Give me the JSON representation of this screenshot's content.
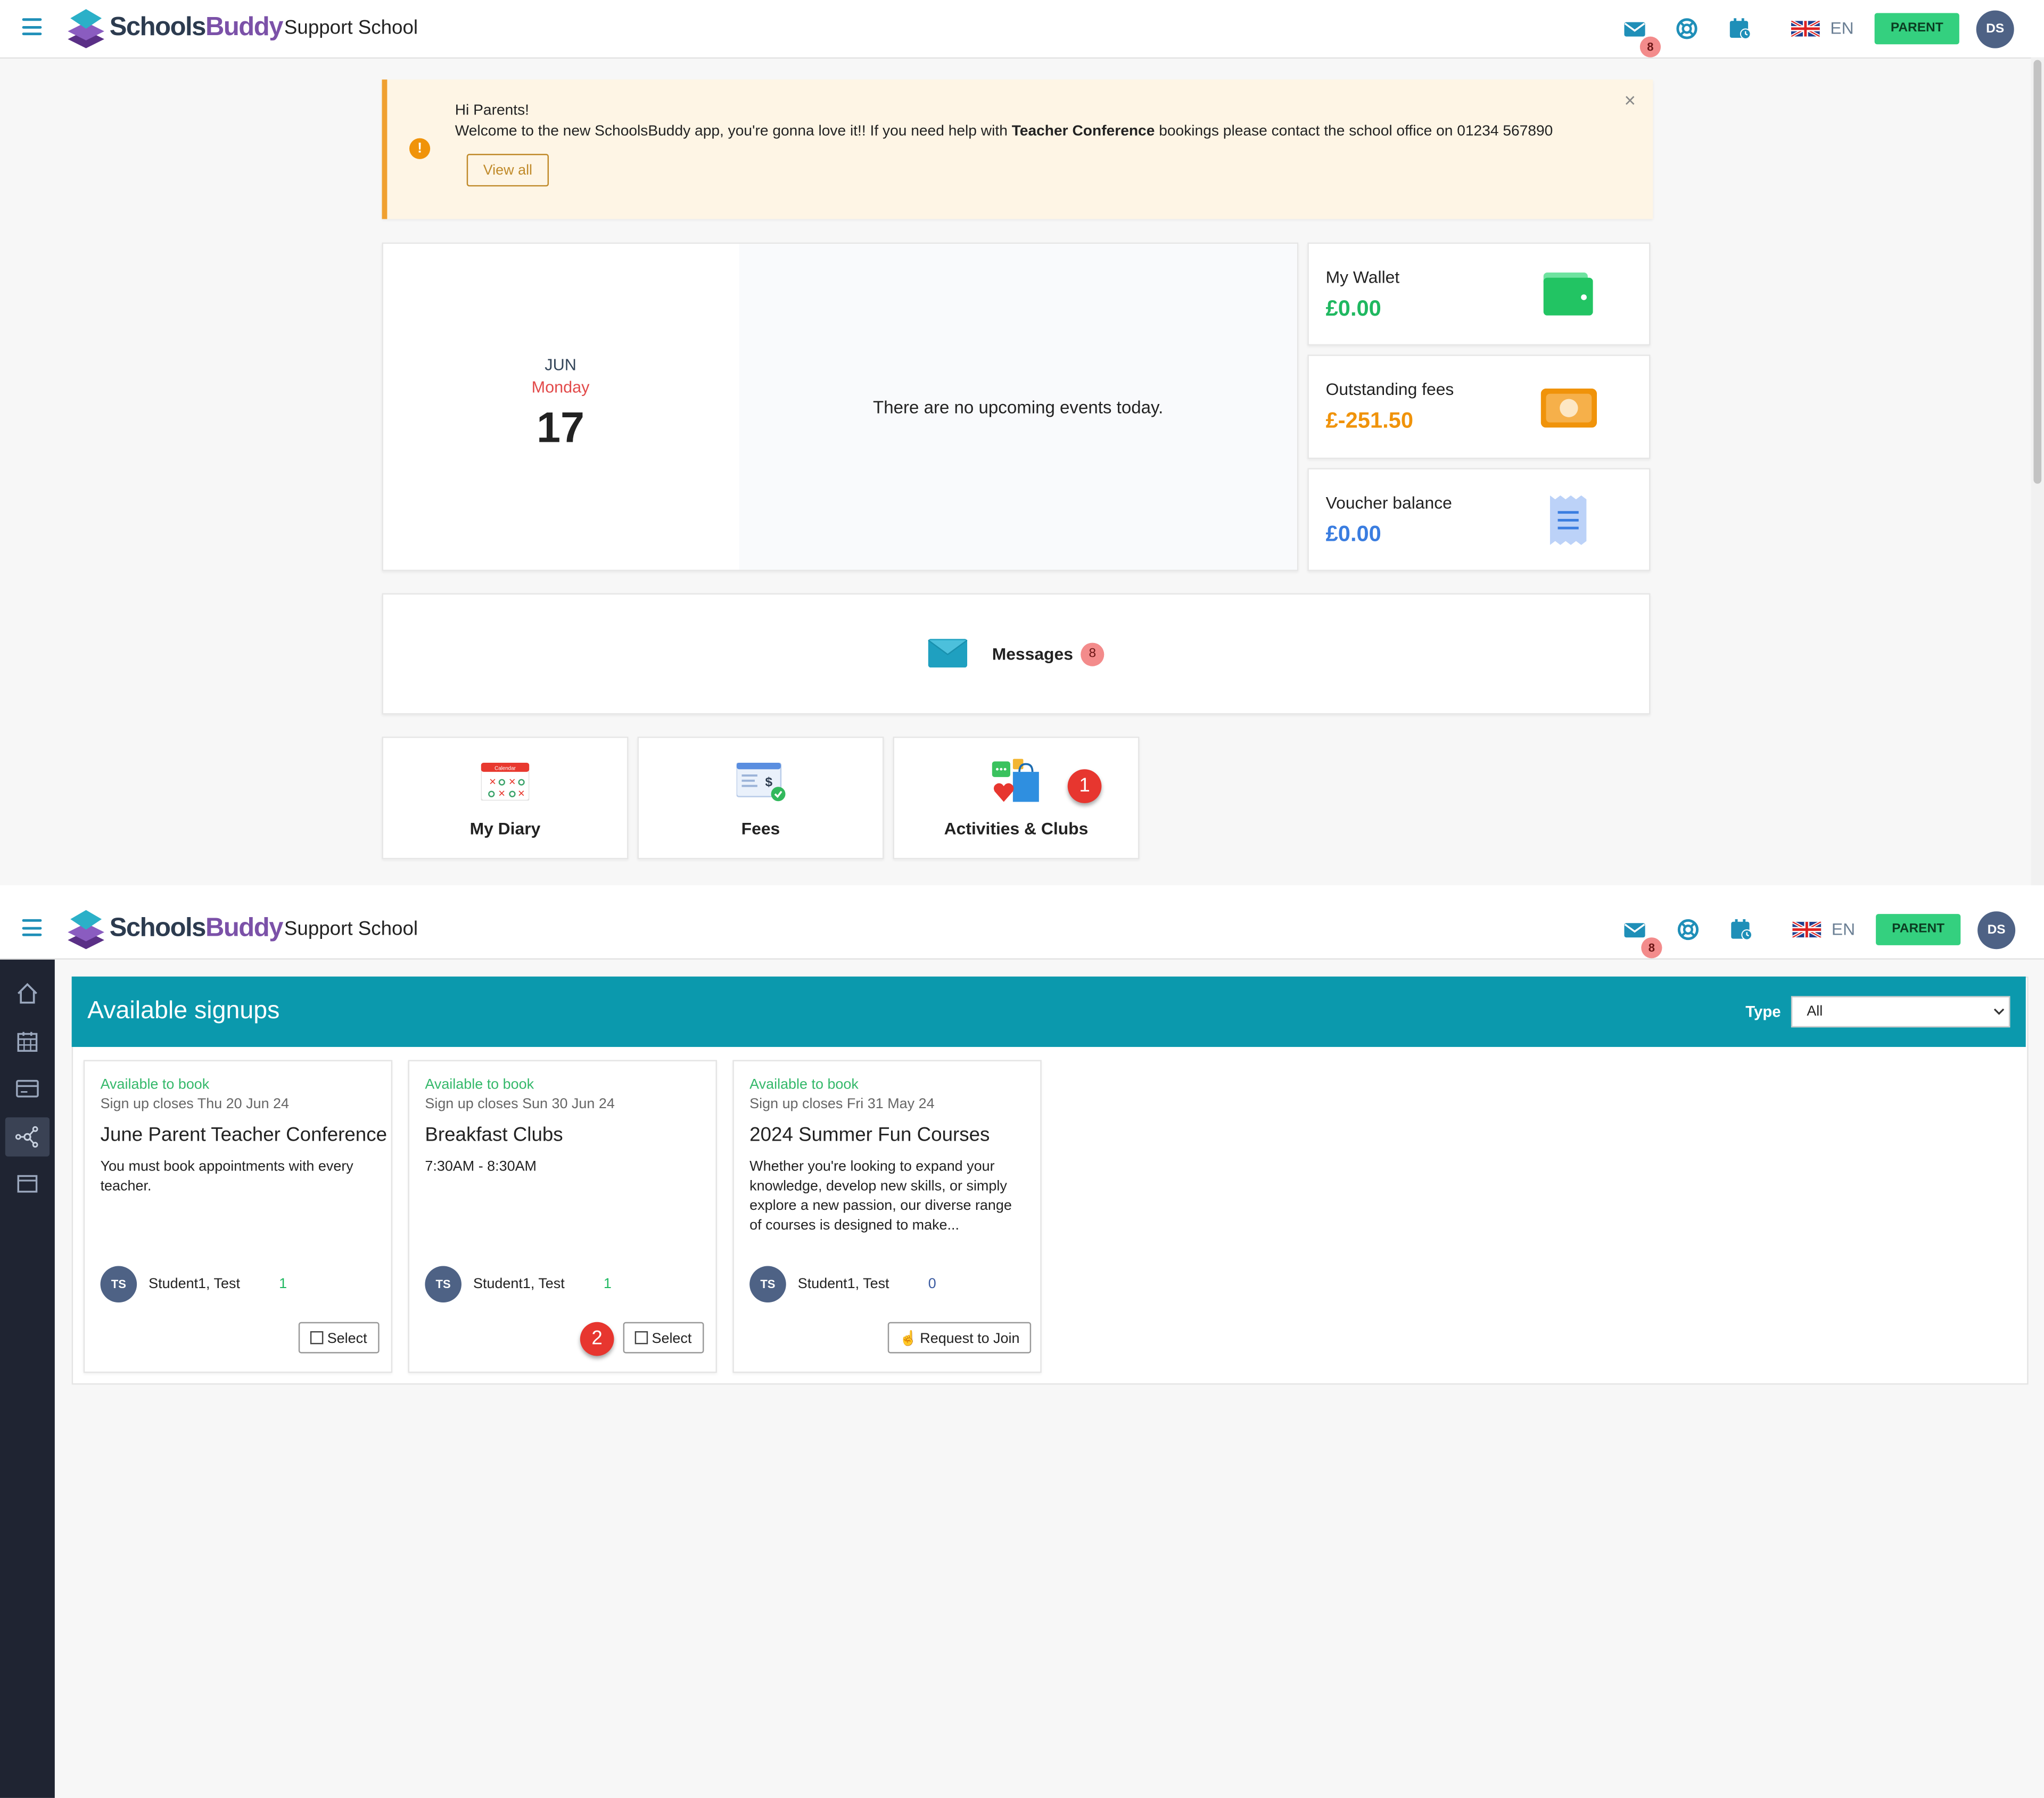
{
  "header": {
    "brand_part1": "Schools",
    "brand_part2": "Buddy",
    "school_name": "Support School",
    "messages_badge": "8",
    "language": "EN",
    "role_button": "PARENT",
    "avatar_initials": "DS"
  },
  "notice": {
    "greeting": "Hi Parents!",
    "text_part1": "Welcome to the new SchoolsBuddy app, you're gonna love it!!  If you need help with ",
    "text_bold": "Teacher Conference",
    "text_part2": " bookings please contact the school office on 01234 567890",
    "view_all": "View all"
  },
  "date_card": {
    "month": "JUN",
    "weekday": "Monday",
    "day": "17",
    "no_events": "There are no upcoming events today."
  },
  "finance": {
    "wallet_label": "My Wallet",
    "wallet_value": "£0.00",
    "fees_label": "Outstanding fees",
    "fees_value": "£-251.50",
    "voucher_label": "Voucher balance",
    "voucher_value": "£0.00"
  },
  "messages_card": {
    "label": "Messages",
    "count": "8"
  },
  "tiles": {
    "diary": "My Diary",
    "diary_icon_text": "Calendar",
    "fees": "Fees",
    "activities": "Activities & Clubs"
  },
  "markers": {
    "step1": "1",
    "step2": "2"
  },
  "signups_page": {
    "title": "Available signups",
    "type_label": "Type",
    "type_selected": "All"
  },
  "signups": [
    {
      "status": "Available to book",
      "closes": "Sign up closes Thu 20 Jun 24",
      "title": "June Parent Teacher Conference",
      "description": "You must book appointments with every teacher.",
      "student_initials": "TS",
      "student": "Student1, Test",
      "count": "1",
      "button": "Select"
    },
    {
      "status": "Available to book",
      "closes": "Sign up closes Sun 30 Jun 24",
      "title": "Breakfast Clubs",
      "description": "7:30AM - 8:30AM",
      "student_initials": "TS",
      "student": "Student1, Test",
      "count": "1",
      "button": "Select"
    },
    {
      "status": "Available to book",
      "closes": "Sign up closes Fri 31 May 24",
      "title": "2024 Summer Fun Courses",
      "description": "Whether you're looking to expand your knowledge, develop new skills, or simply explore a new passion, our diverse range of courses is designed to make...",
      "student_initials": "TS",
      "student": "Student1, Test",
      "count": "0",
      "button": "Request to Join"
    }
  ],
  "colors": {
    "accent": "#1f8fb8",
    "teal_banner": "#0b99ad",
    "green": "#1fb860",
    "orange": "#f0930a",
    "blue": "#3a7de0",
    "parent_green": "#34d07f",
    "sidebar": "#1f2432"
  },
  "icons": [
    "menu-icon",
    "envelope-icon",
    "lifebuoy-icon",
    "calendar-clock-icon",
    "uk-flag-icon",
    "wallet-icon",
    "banknote-icon",
    "receipt-icon",
    "home-icon",
    "calendar-icon",
    "card-icon",
    "network-icon",
    "window-icon",
    "checkbox-icon",
    "hand-pointer-icon"
  ]
}
